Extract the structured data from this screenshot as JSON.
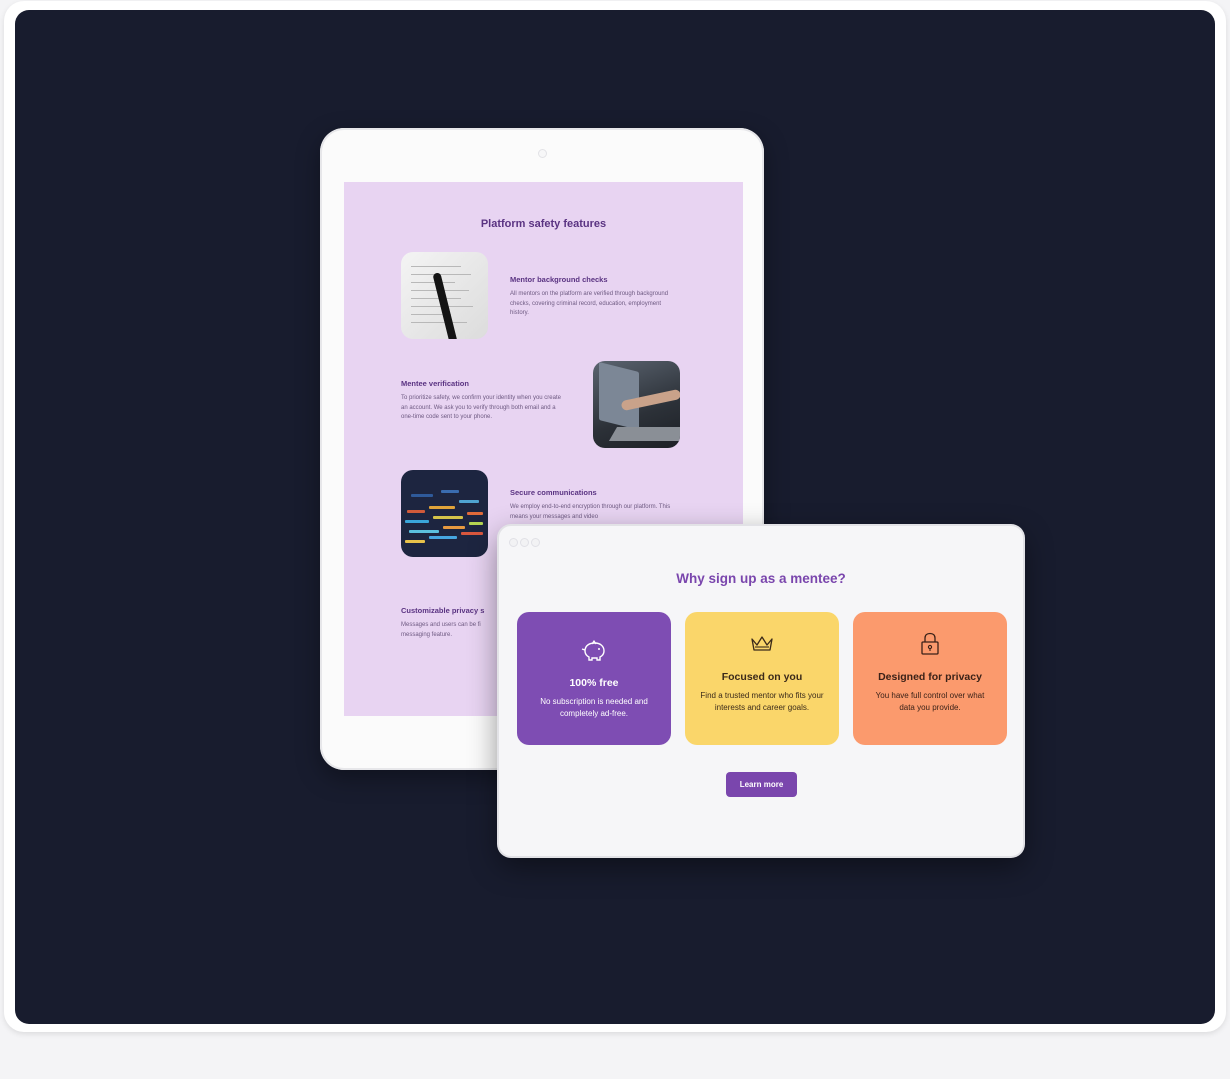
{
  "colors": {
    "stage": "#181c2e",
    "tablet_screen": "#e8d4f2",
    "purple": "#7a46ad",
    "card_purple": "#7e4db3",
    "card_yellow": "#fad66a",
    "card_orange": "#fb9a6d"
  },
  "tablet": {
    "title": "Platform safety features",
    "features": [
      {
        "image_icon": "document-pen-photo",
        "title": "Mentor background checks",
        "body": "All mentors on the platform are verified through background checks, covering criminal record, education, employment history."
      },
      {
        "image_icon": "laptop-hand-photo",
        "title": "Mentee verification",
        "body": "To prioritize safety, we confirm your identity when you create an account. We ask you to verify through both email and a one-time code sent to your phone."
      },
      {
        "image_icon": "code-screen-photo",
        "title": "Secure communications",
        "body": "We employ end-to-end encryption through our platform. This means your messages and video"
      },
      {
        "title": "Customizable privacy s",
        "body": "Messages and users can be fi messaging feature."
      }
    ]
  },
  "window": {
    "title": "Why sign up as a mentee?",
    "cards": [
      {
        "icon": "piggy-bank-icon",
        "title": "100% free",
        "body": "No subscription is needed and completely ad-free."
      },
      {
        "icon": "crown-icon",
        "title": "Focused on you",
        "body": "Find a trusted mentor who fits your interests and career goals."
      },
      {
        "icon": "padlock-icon",
        "title": "Designed for privacy",
        "body": "You have full control over what data you provide."
      }
    ],
    "button_label": "Learn more"
  }
}
